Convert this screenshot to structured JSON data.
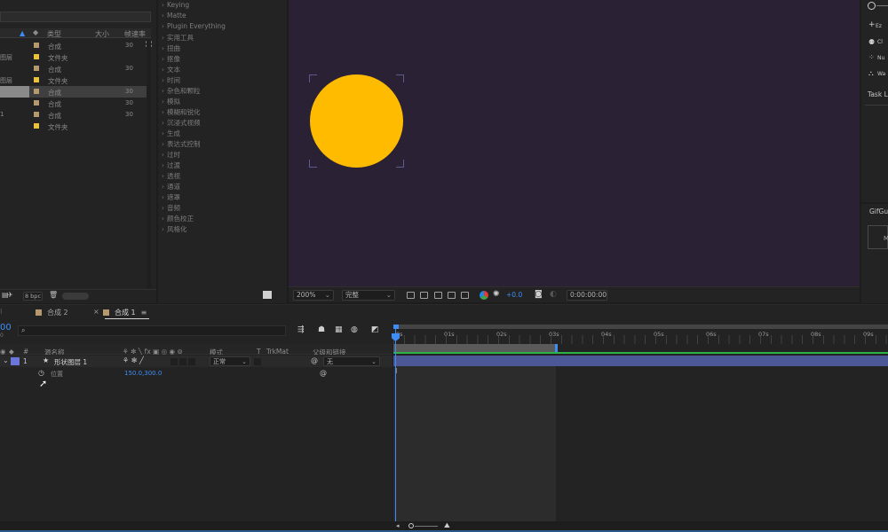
{
  "project": {
    "headers": {
      "type": "类型",
      "size": "大小",
      "fps": "帧速率"
    },
    "rows": [
      {
        "name": "",
        "swatch": "#b59a6f",
        "type": "合成",
        "fps": "30"
      },
      {
        "name": "图层",
        "swatch": "#e8c23a",
        "type": "文件夹",
        "fps": ""
      },
      {
        "name": "",
        "swatch": "#b59a6f",
        "type": "合成",
        "fps": "30"
      },
      {
        "name": "图层",
        "swatch": "#e8c23a",
        "type": "文件夹",
        "fps": ""
      },
      {
        "name": "",
        "swatch": "#b59a6f",
        "type": "合成",
        "fps": "30"
      },
      {
        "name": "",
        "swatch": "#b59a6f",
        "type": "合成",
        "fps": "30"
      },
      {
        "name": "1",
        "swatch": "#b59a6f",
        "type": "合成",
        "fps": "30"
      },
      {
        "name": "",
        "swatch": "#e8c23a",
        "type": "文件夹",
        "fps": ""
      }
    ],
    "bpc": "8 bpc"
  },
  "effects": {
    "items": [
      "Keying",
      "Matte",
      "Plugin Everything",
      "实用工具",
      "扭曲",
      "抠像",
      "文本",
      "时间",
      "杂色和颗粒",
      "模拟",
      "模糊和锐化",
      "沉浸式视频",
      "生成",
      "表达式控制",
      "过时",
      "过渡",
      "透视",
      "通道",
      "遮罩",
      "音频",
      "颜色校正",
      "风格化"
    ]
  },
  "viewer": {
    "zoom": "200%",
    "quality": "完整",
    "exposure": "+0.0",
    "timecode": "0:00:00:00",
    "colors": {
      "background": "#2b2135",
      "circle": "#ffbb00"
    }
  },
  "right": {
    "items": [
      "Ez",
      "Cl",
      "Nu",
      "Wa"
    ],
    "task": "Task L",
    "gif": "GifGu",
    "gif_btn": "M"
  },
  "timeline": {
    "tabs": [
      {
        "label": "合成 2"
      },
      {
        "label": "合成 1"
      }
    ],
    "current_time": "00",
    "search_placeholder": "",
    "columns": {
      "num": "#",
      "source": "源名称",
      "mode": "模式",
      "t": "T",
      "trkmat": "TrkMat",
      "parent": "父级和链接"
    },
    "layer": {
      "index": "1",
      "name": "形状图层 1",
      "mode": "正常",
      "parent": "无",
      "color": "#6b76d8"
    },
    "property": {
      "name": "位置",
      "value": "150.0,300.0"
    },
    "ruler": [
      "0s",
      "01s",
      "02s",
      "03s",
      "04s",
      "05s",
      "06s",
      "07s",
      "08s",
      "09s"
    ]
  }
}
